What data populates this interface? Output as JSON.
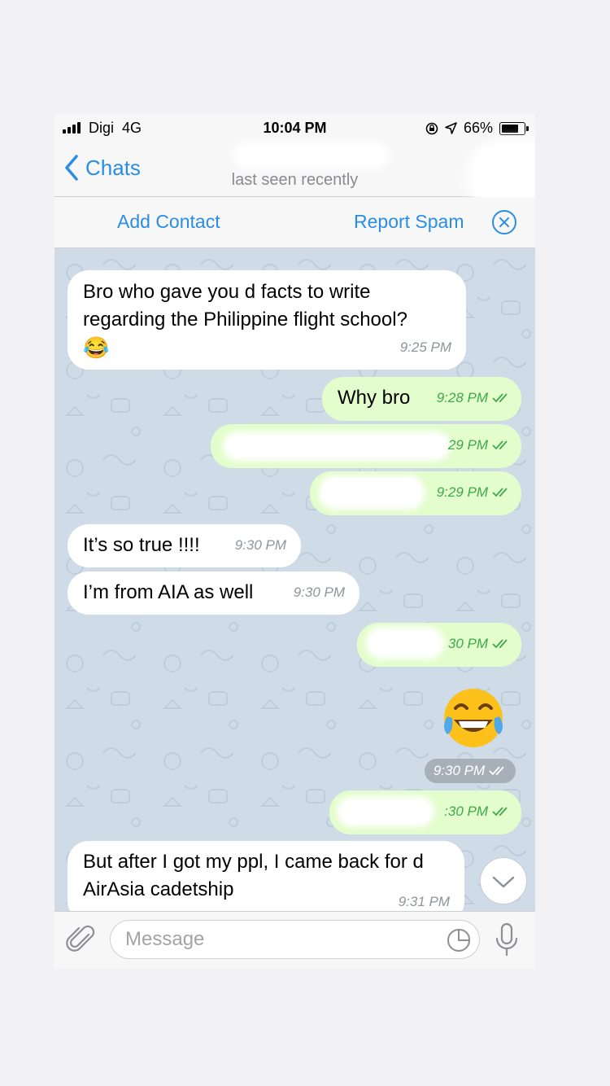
{
  "status_bar": {
    "carrier": "Digi",
    "network": "4G",
    "time": "10:04 PM",
    "battery": "66%",
    "battery_level": 0.66
  },
  "header": {
    "back_label": "Chats",
    "contact_name": "",
    "last_seen": "last seen recently"
  },
  "action_bar": {
    "add_contact": "Add Contact",
    "report_spam": "Report Spam"
  },
  "messages": [
    {
      "direction": "in",
      "text": "Bro who gave you d facts to write regarding the Philippine flight school?",
      "emoji": "😂",
      "time": "9:25 PM"
    },
    {
      "direction": "out",
      "text": "Why bro",
      "time": "9:28 PM",
      "status": "read"
    },
    {
      "direction": "out",
      "text": "",
      "time": "9:29 PM",
      "time_visible": "29 PM",
      "redacted": true,
      "status": "read"
    },
    {
      "direction": "out",
      "text": "",
      "time": "9:29 PM",
      "redacted": true,
      "status": "read"
    },
    {
      "direction": "in",
      "text": "It’s so true !!!!",
      "time": "9:30 PM"
    },
    {
      "direction": "in",
      "text": "I’m from AIA as well",
      "time": "9:30 PM"
    },
    {
      "direction": "out",
      "text": "",
      "time": "9:30 PM",
      "time_visible": "30 PM",
      "redacted": true,
      "status": "read"
    },
    {
      "direction": "out",
      "type": "emoji",
      "emoji": "😂",
      "time": "9:30 PM",
      "status": "read"
    },
    {
      "direction": "out",
      "text": "",
      "time": "9:30 PM",
      "time_visible": ":30 PM",
      "redacted": true,
      "status": "read"
    },
    {
      "direction": "in",
      "text": "But after I got my ppl, I came back for d AirAsia cadetship",
      "time": "9:31 PM"
    }
  ],
  "input_bar": {
    "placeholder": "Message"
  },
  "colors": {
    "accent": "#2b8de4",
    "chat_background": "#cfdbe7",
    "incoming_bubble": "#ffffff",
    "outgoing_bubble": "#e3fdcc",
    "outgoing_time": "#3ea94d"
  },
  "icons": [
    "signal-icon",
    "orientation-lock-icon",
    "location-arrow-icon",
    "battery-icon",
    "back-chevron-icon",
    "close-circle-icon",
    "double-check-icon",
    "scroll-down-chevron-icon",
    "paperclip-icon",
    "sticker-icon",
    "microphone-icon"
  ]
}
